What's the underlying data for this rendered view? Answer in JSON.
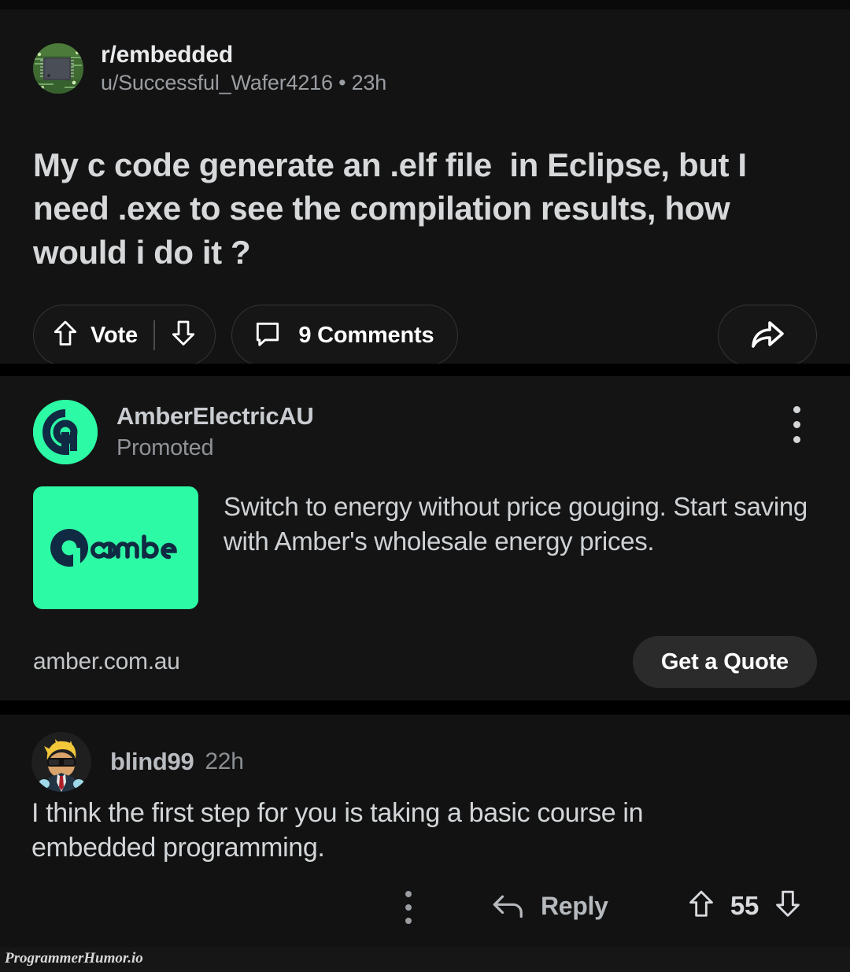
{
  "post": {
    "subreddit": "r/embedded",
    "meta": "u/Successful_Wafer4216 • 23h",
    "title": "My c code generate an .elf file  in Eclipse, but I need .exe to see the compilation results, how would i do it ?",
    "vote_label": "Vote",
    "comments_label": "9 Comments",
    "avatar_alt": "circuit-board-chip",
    "icons": {
      "upvote": "upvote-arrow-icon",
      "downvote": "downvote-arrow-icon",
      "comment": "comment-bubble-icon",
      "share": "share-arrow-icon"
    }
  },
  "ad": {
    "advertiser": "AmberElectricAU",
    "promoted_label": "Promoted",
    "thumb_brand": "amber",
    "copy": "Switch to energy without price gouging. Start saving with Amber's wholesale energy prices.",
    "url": "amber.com.au",
    "cta_label": "Get a Quote",
    "brand_green": "#2dfaa4",
    "brand_navy": "#102a43",
    "kebab_icon": "kebab-menu-icon"
  },
  "comment": {
    "username": "blind99",
    "timestamp": "22h",
    "body": "I think the first step for you is taking a basic course in embedded programming.",
    "reply_label": "Reply",
    "score": "55",
    "kebab_icon": "kebab-menu-icon",
    "reply_icon": "reply-arrow-icon",
    "upvote_icon": "upvote-arrow-icon",
    "downvote_icon": "downvote-arrow-icon"
  },
  "watermark": "ProgrammerHumor.io"
}
